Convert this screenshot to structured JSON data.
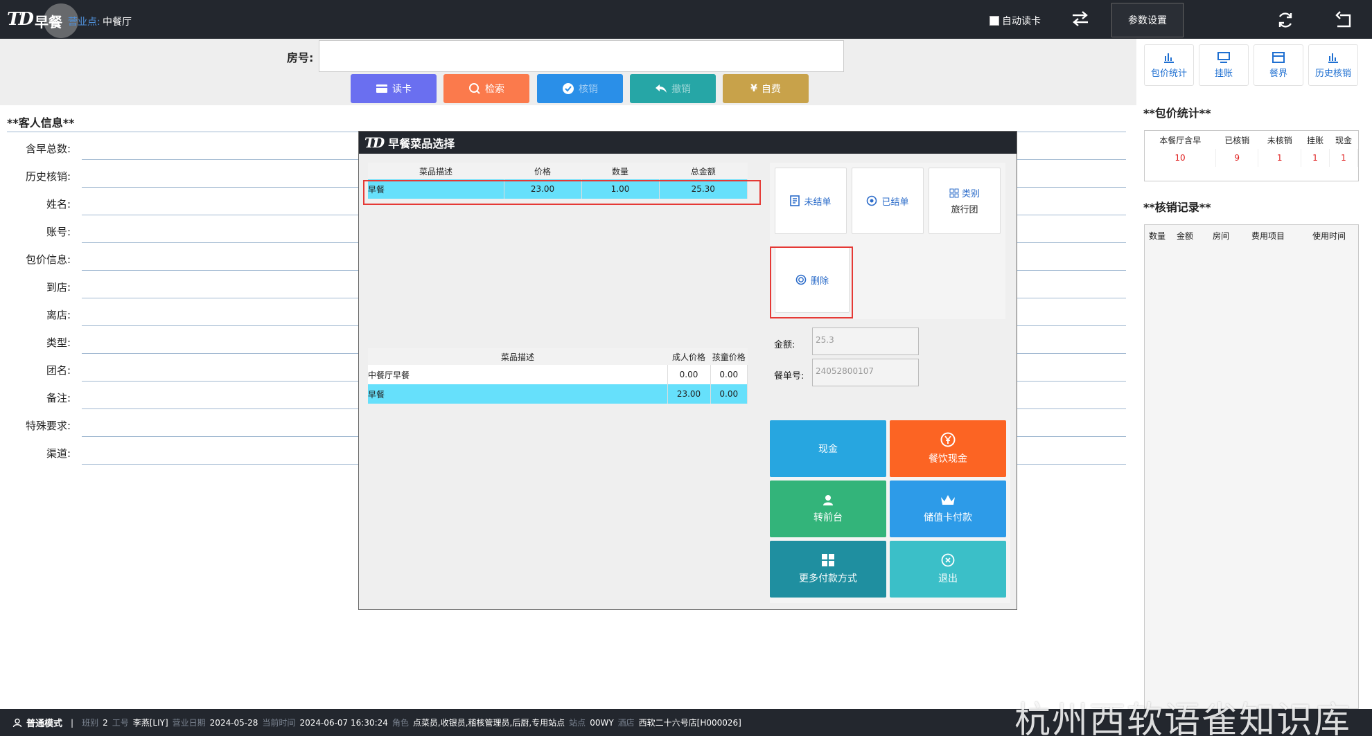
{
  "topbar": {
    "title": "早餐",
    "biz_point_label": "营业点:",
    "biz_point_value": "中餐厅",
    "auto_read_label": "自动读卡",
    "params_button": "参数设置"
  },
  "room": {
    "label": "房号:",
    "value": ""
  },
  "toolbar": {
    "read_card": "读卡",
    "search": "检索",
    "verify": "核销",
    "undo": "撤销",
    "self_pay": "自费"
  },
  "side_buttons": {
    "package_stats": "包价统计",
    "charge": "挂账",
    "meal_session": "餐界",
    "history_verify": "历史核销"
  },
  "guest_info": {
    "header": "**客人信息**",
    "fields": [
      "含早总数:",
      "历史核销:",
      "姓名:",
      "账号:",
      "包价信息:",
      "到店:",
      "离店:",
      "类型:",
      "团名:",
      "备注:",
      "特殊要求:",
      "渠道:"
    ]
  },
  "package_stats": {
    "header": "**包价统计**",
    "columns": [
      "本餐厅含早",
      "已核销",
      "未核销",
      "挂账",
      "现金"
    ],
    "values": [
      "10",
      "9",
      "1",
      "1",
      "1"
    ]
  },
  "verify_records": {
    "header": "**核销记录**",
    "columns": [
      "数量",
      "金额",
      "房间",
      "费用项目",
      "使用时间"
    ]
  },
  "modal": {
    "title": "早餐菜品选择",
    "order_table": {
      "columns": [
        "菜品描述",
        "价格",
        "数量",
        "总金额"
      ],
      "rows": [
        [
          "早餐",
          "23.00",
          "1.00",
          "25.30"
        ]
      ]
    },
    "menu_table": {
      "columns": [
        "菜品描述",
        "成人价格",
        "孩童价格"
      ],
      "rows": [
        [
          "中餐厅早餐",
          "0.00",
          "0.00"
        ],
        [
          "早餐",
          "23.00",
          "0.00"
        ]
      ]
    },
    "buttons": {
      "unsettled": "未结单",
      "settled": "已结单",
      "category": "类别",
      "category_sub": "旅行团",
      "delete": "删除"
    },
    "amount_label": "金额:",
    "amount_value": "25.3",
    "order_no_label": "餐单号:",
    "order_no_value": "24052800107",
    "payments": {
      "cash": "现金",
      "dining_cash": "餐饮现金",
      "to_front": "转前台",
      "stored_card": "储值卡付款",
      "more": "更多付款方式",
      "exit": "退出"
    }
  },
  "footer": {
    "mode": "普通模式",
    "shift_label": "班别",
    "shift": "2",
    "worker_label": "工号",
    "worker": "李燕[LIY]",
    "biz_date_label": "营业日期",
    "biz_date": "2024-05-28",
    "now_label": "当前时间",
    "now": "2024-06-07 16:30:24",
    "role_label": "角色",
    "roles": "点菜员,收银员,稽核管理员,后厨,专用站点",
    "station_label": "站点",
    "station": "00WY",
    "hotel_label": "酒店",
    "hotel": "西软二十六号店[H000026]"
  },
  "watermark": "杭州西软语雀知识库",
  "colors": {
    "topbar": "#23272e",
    "read_card": "#6a6ff0",
    "search": "#fb7a4c",
    "verify": "#2a8fe8",
    "undo": "#26a6a6",
    "self_pay": "#c8a24a",
    "selected_row": "#66e0fb",
    "highlight_box": "#e53935",
    "cash": "#27a6e0",
    "dining_cash": "#fc6423",
    "to_front": "#33b47a",
    "stored_card": "#2d9be8",
    "more": "#1f8fa0",
    "exit": "#3bbfc8"
  }
}
